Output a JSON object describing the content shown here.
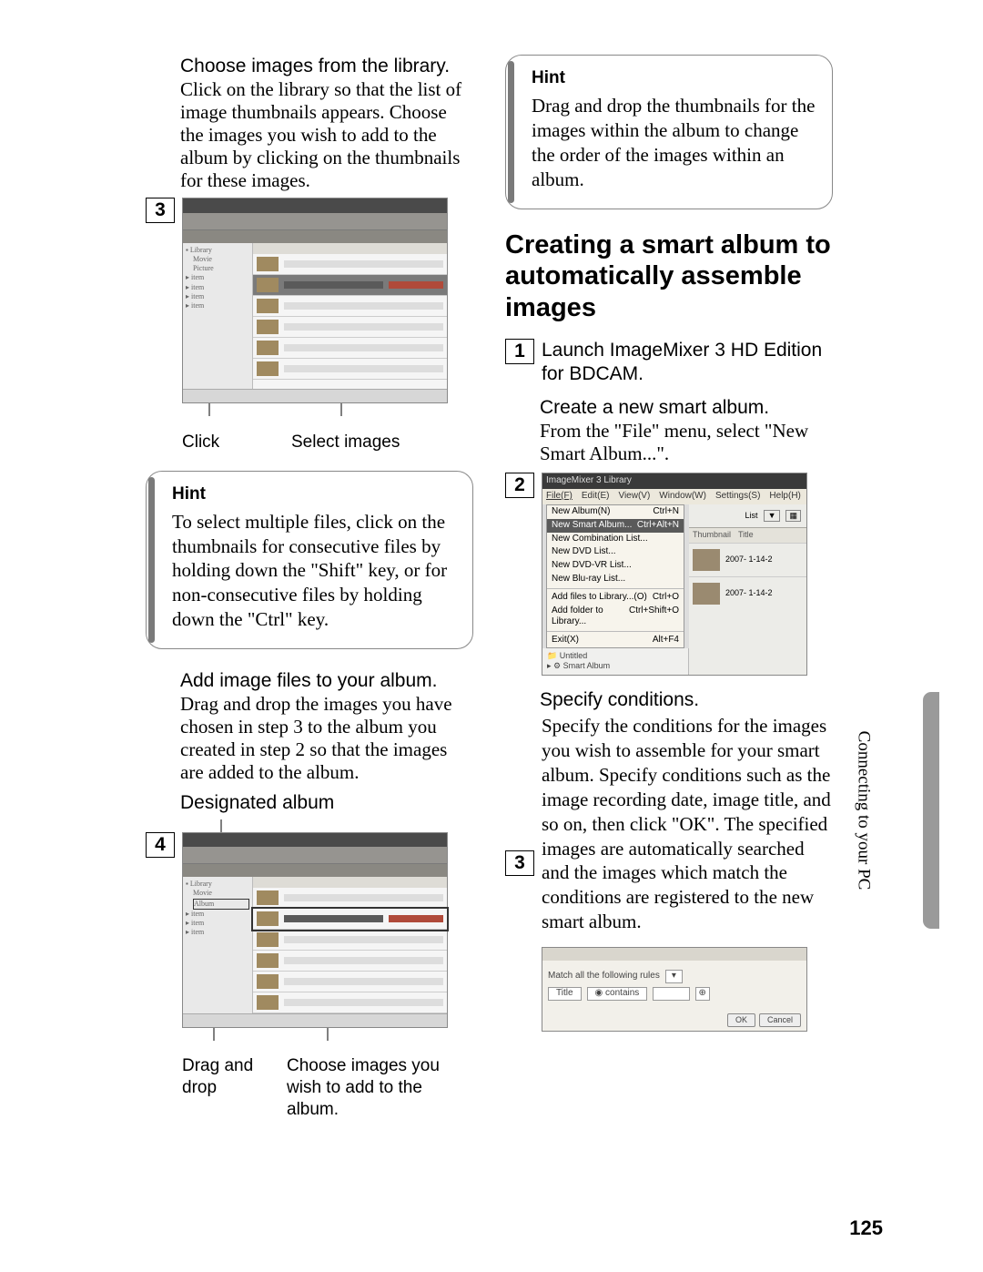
{
  "left": {
    "step3": {
      "num": "3",
      "title": "Choose images from the library.",
      "text": "Click on the library so that the list of image thumbnails appears. Choose the images you wish to add to the album by clicking on the thumbnails for these images.",
      "callout_click": "Click",
      "callout_select": "Select images"
    },
    "hint": {
      "title": "Hint",
      "text": "To select multiple files, click on the thumbnails for consecutive files by holding down the \"Shift\" key, or for non-consecutive files by holding down the \"Ctrl\" key."
    },
    "step4": {
      "num": "4",
      "title": "Add image files to your album.",
      "text": "Drag and drop the images you have chosen in step 3 to the album you created in step 2 so that the images are added to the album.",
      "label_designated": "Designated album",
      "callout_drag": "Drag and drop",
      "callout_choose": "Choose images you wish to add to the album."
    }
  },
  "right": {
    "hint_top": {
      "title": "Hint",
      "text": "Drag and drop the thumbnails for the images within the album to change the order of the images within an album."
    },
    "heading": "Creating a smart album to automatically assemble images",
    "step1": {
      "num": "1",
      "text": "Launch ImageMixer 3 HD Edition for BDCAM."
    },
    "step2": {
      "num": "2",
      "title": "Create a new smart album.",
      "text": "From the \"File\" menu, select \"New Smart Album...\".",
      "ss_window_title": "ImageMixer 3 Library",
      "menubar": {
        "file": "File(F)",
        "edit": "Edit(E)",
        "view": "View(V)",
        "window": "Window(W)",
        "settings": "Settings(S)",
        "help": "Help(H)"
      },
      "menu": {
        "new_album": "New Album(N)",
        "new_album_key": "Ctrl+N",
        "new_smart": "New Smart Album...",
        "new_smart_key": "Ctrl+Alt+N",
        "new_combo": "New Combination List...",
        "new_dvd": "New DVD List...",
        "new_dvdvr": "New DVD-VR List...",
        "new_bluray": "New Blu-ray List...",
        "add_files": "Add files to Library...(O)",
        "add_files_key": "Ctrl+O",
        "add_folder": "Add folder to Library...",
        "add_folder_key": "Ctrl+Shift+O",
        "exit": "Exit(X)",
        "exit_key": "Alt+F4"
      },
      "rightpane": {
        "list": "List",
        "thumbnail": "Thumbnail",
        "title": "Title",
        "date1": "2007- 1-14-2",
        "date2": "2007- 1-14-2"
      },
      "lowerleft": {
        "untitled": "Untitled",
        "smart": "Smart Album"
      }
    },
    "step3": {
      "num": "3",
      "title": "Specify conditions.",
      "text": "Specify the conditions for the images you wish to assemble for your smart album. Specify conditions such as the image recording date, image title, and so on, then click \"OK\". The specified images are automatically searched and the images which match the conditions are registered to the new smart album.",
      "dlg": {
        "match": "Match all the following rules",
        "field_title": "Title",
        "op": "contains",
        "ok": "OK",
        "cancel": "Cancel"
      }
    }
  },
  "side_tab": "Connecting to your PC",
  "page_number": "125"
}
